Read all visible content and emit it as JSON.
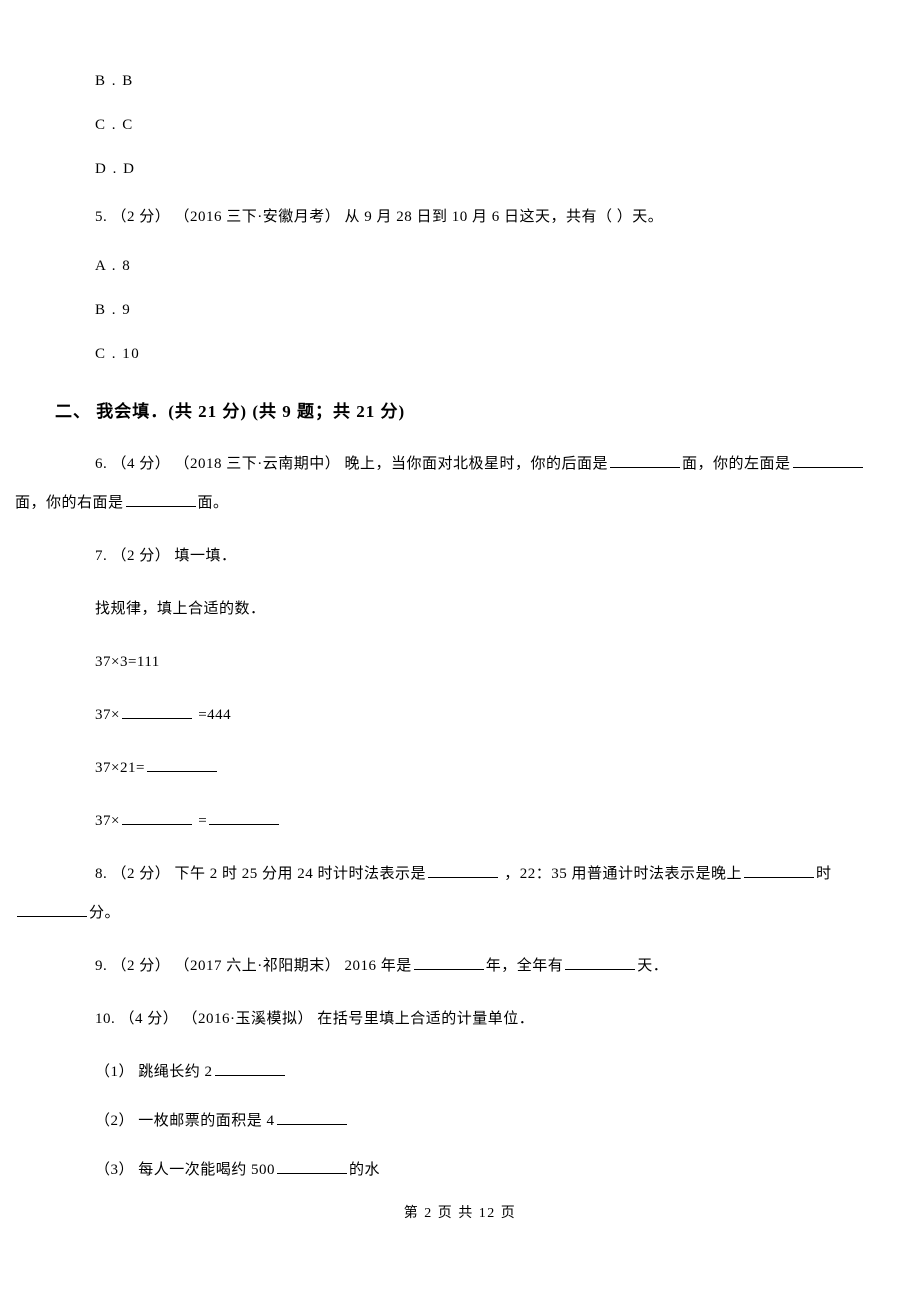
{
  "options_prev": {
    "b": "B . B",
    "c": "C . C",
    "d": "D . D"
  },
  "q5": {
    "stem": "5. （2 分） （2016 三下·安徽月考） 从 9 月 28 日到 10 月 6 日这天，共有（    ）天。",
    "a": "A . 8",
    "b": "B . 9",
    "c": "C . 10"
  },
  "section2": "二、 我会填．(共 21 分)  (共 9 题；共 21 分)",
  "q6": {
    "prefix": "6. （4 分） （2018 三下·云南期中） 晚上，当你面对北极星时，你的后面是",
    "mid1": "面，你的左面是",
    "line2_prefix": "面，你的右面是",
    "suffix": "面。"
  },
  "q7": {
    "stem": "7. （2 分） 填一填．",
    "line1": "找规律，填上合适的数．",
    "line2": "37×3=111",
    "line3_prefix": "37×",
    "line3_suffix": "   =444",
    "line4_prefix": "37×21=",
    "line5_prefix": "37×",
    "line5_mid": "   ="
  },
  "q8": {
    "prefix": "8. （2 分） 下午 2 时 25 分用 24 时计时法表示是",
    "mid": "  ，22：35 用普通计时法表示是晚上",
    "suffix1": "时",
    "suffix2": "分。"
  },
  "q9": {
    "prefix": "9. （2 分） （2017 六上·祁阳期末） 2016 年是",
    "mid": "年，全年有",
    "suffix": "天．"
  },
  "q10": {
    "stem": "10. （4 分） （2016·玉溪模拟） 在括号里填上合适的计量单位．",
    "s1_prefix": "（1） 跳绳长约 2",
    "s2_prefix": "（2） 一枚邮票的面积是 4",
    "s3_prefix": "（3） 每人一次能喝约 500",
    "s3_suffix": "的水"
  },
  "footer": "第 2 页 共 12 页"
}
